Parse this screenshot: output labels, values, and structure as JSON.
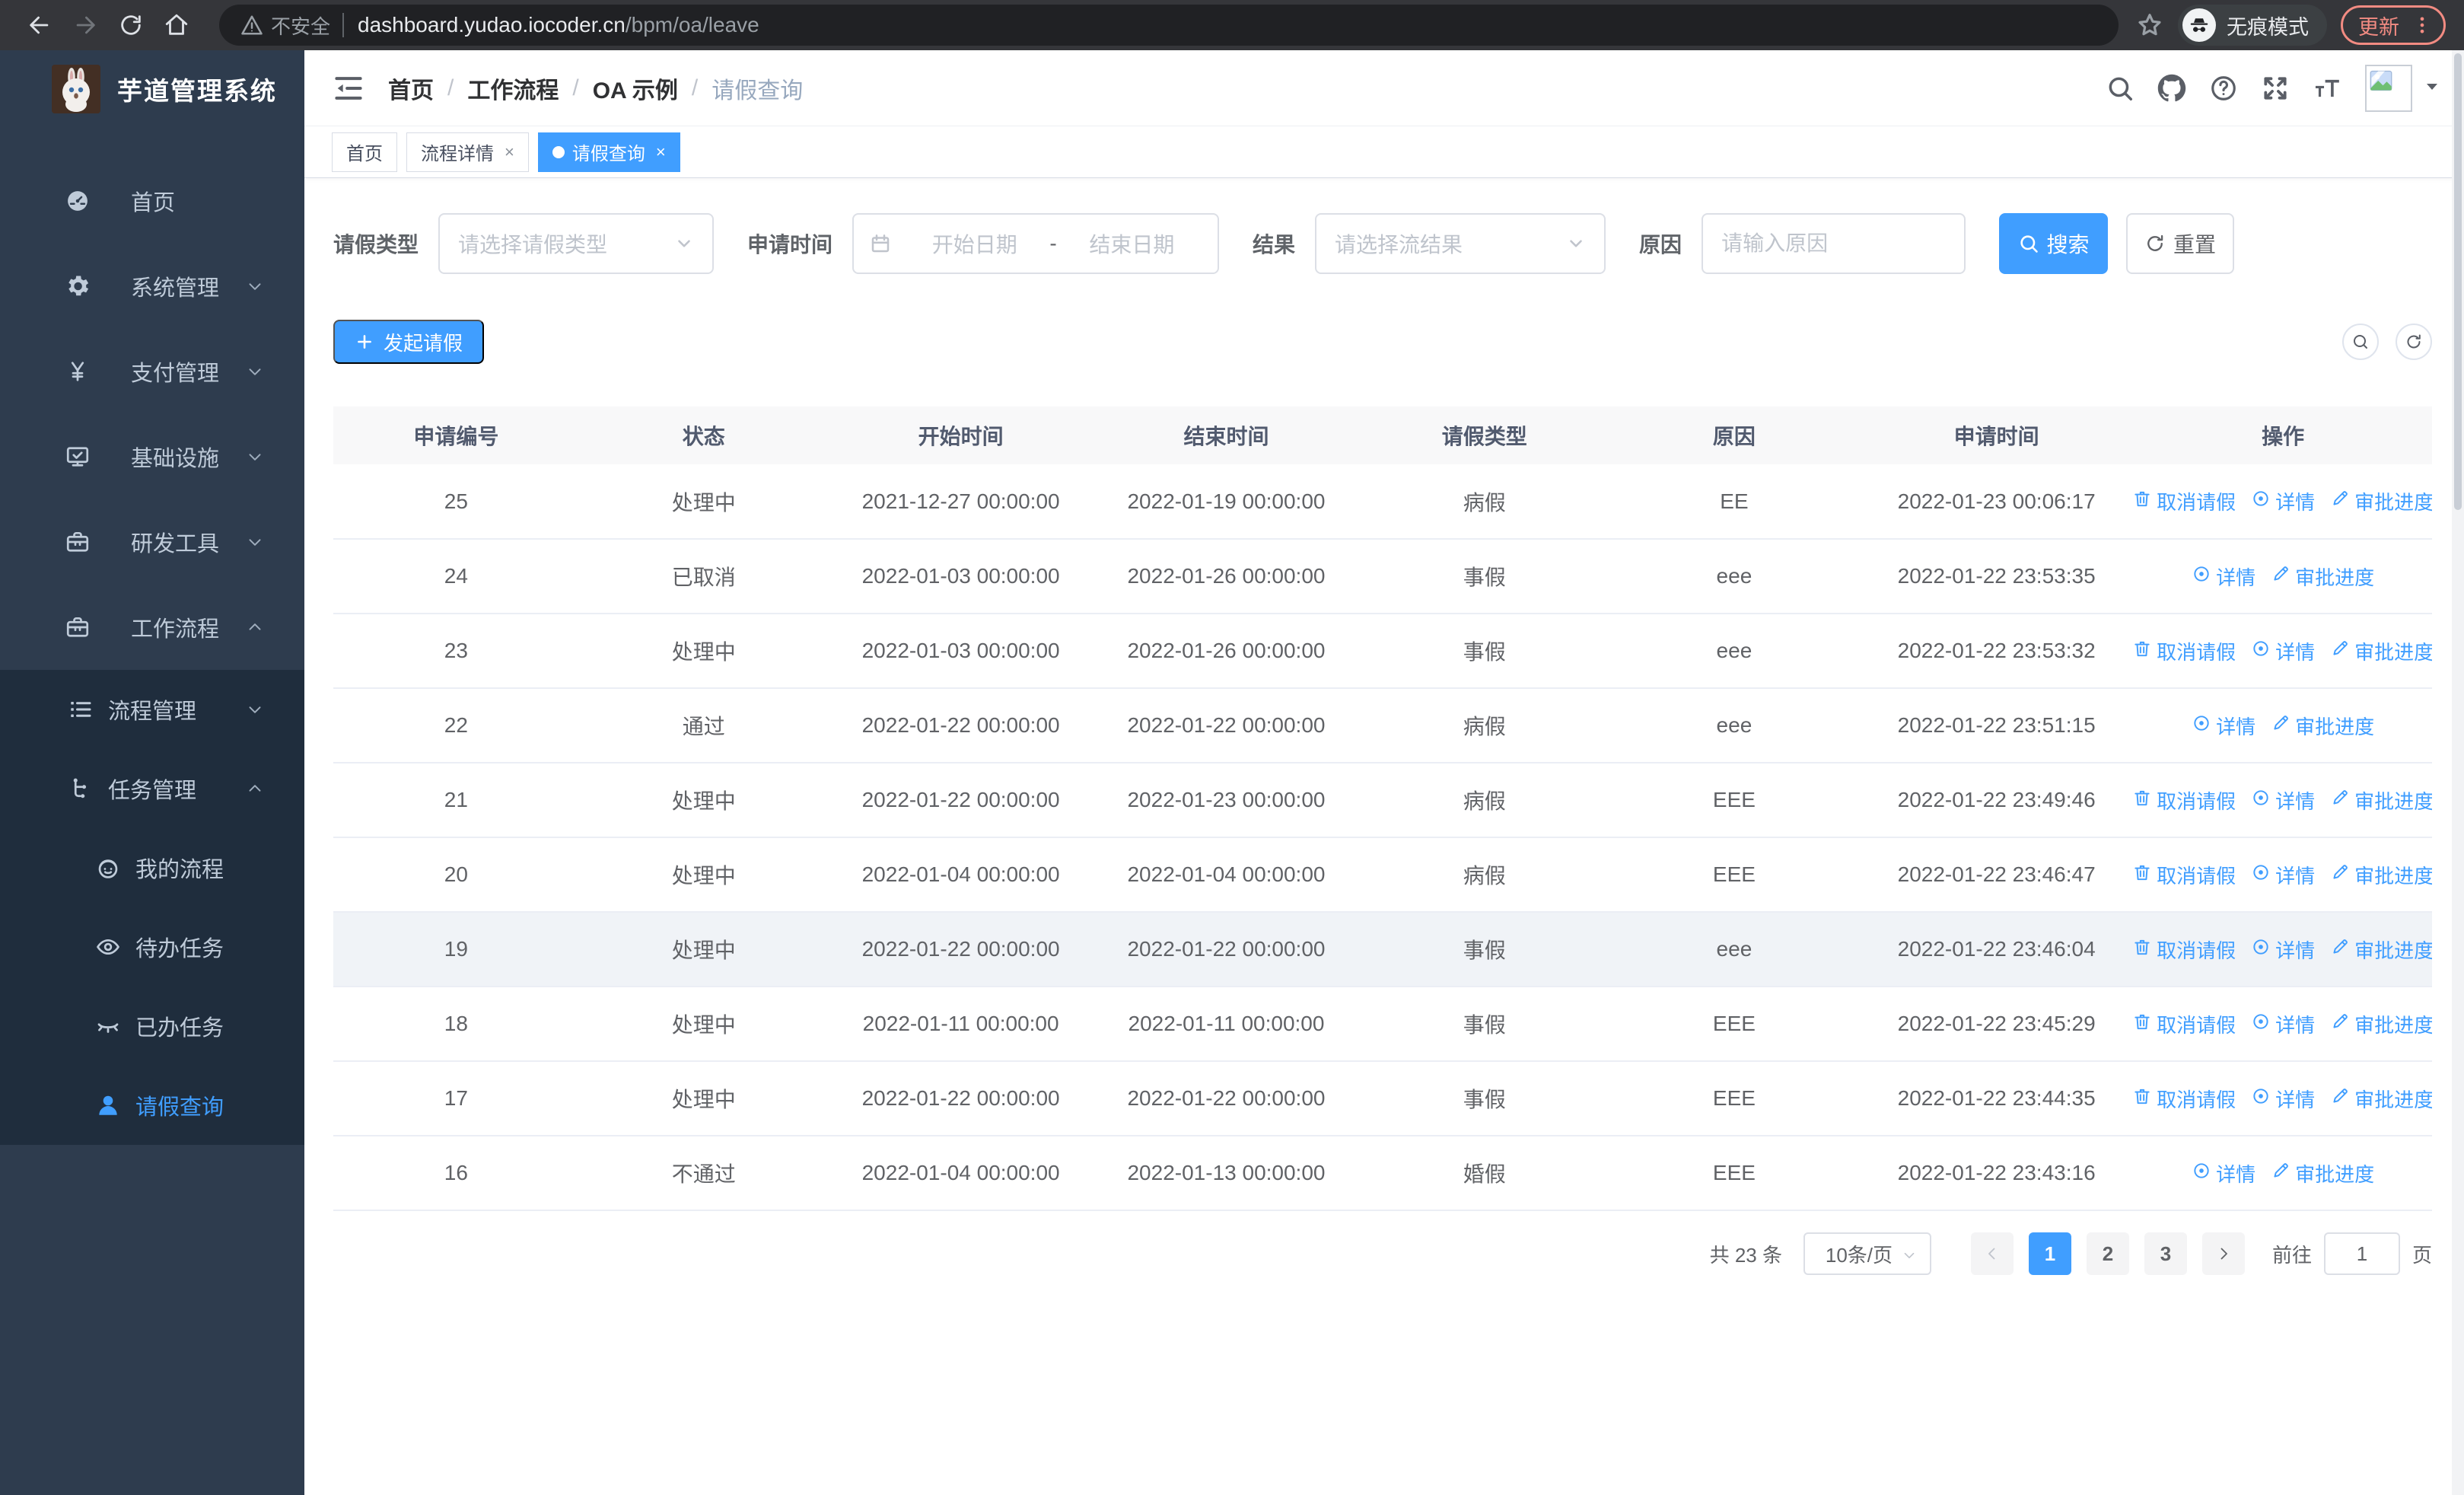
{
  "browser": {
    "security_label": "不安全",
    "url_host": "dashboard.yudao.iocoder.cn",
    "url_path": "/bpm/oa/leave",
    "incognito_label": "无痕模式",
    "update_label": "更新"
  },
  "sidebar": {
    "title": "芋道管理系统",
    "menu": [
      {
        "label": "首页",
        "icon": "dashboard-icon",
        "level": 1,
        "arrow": null,
        "active": false
      },
      {
        "label": "系统管理",
        "icon": "gear-icon",
        "level": 1,
        "arrow": "down",
        "active": false
      },
      {
        "label": "支付管理",
        "icon": "yen-icon",
        "level": 1,
        "arrow": "down",
        "active": false
      },
      {
        "label": "基础设施",
        "icon": "monitor-icon",
        "level": 1,
        "arrow": "down",
        "active": false
      },
      {
        "label": "研发工具",
        "icon": "toolbox-icon",
        "level": 1,
        "arrow": "down",
        "active": false
      },
      {
        "label": "工作流程",
        "icon": "briefcase-icon",
        "level": 1,
        "arrow": "up",
        "active": false
      }
    ],
    "submenu": [
      {
        "label": "流程管理",
        "icon": "tree-list-icon",
        "level": 2,
        "arrow": "down",
        "active": false
      },
      {
        "label": "任务管理",
        "icon": "org-branch-icon",
        "level": 2,
        "arrow": "up",
        "active": false
      },
      {
        "label": "我的流程",
        "icon": "face-icon",
        "level": 3,
        "arrow": null,
        "active": false
      },
      {
        "label": "待办任务",
        "icon": "eye-open-icon",
        "level": 3,
        "arrow": null,
        "active": false
      },
      {
        "label": "已办任务",
        "icon": "eye-closed-icon",
        "level": 3,
        "arrow": null,
        "active": false
      },
      {
        "label": "请假查询",
        "icon": "user-icon",
        "level": 3,
        "arrow": null,
        "active": true
      }
    ]
  },
  "header": {
    "breadcrumb": [
      "首页",
      "工作流程",
      "OA 示例",
      "请假查询"
    ],
    "icons": [
      "search-icon",
      "github-icon",
      "help-icon",
      "fullscreen-icon",
      "font-size-icon"
    ]
  },
  "tabs": [
    {
      "label": "首页",
      "closable": false,
      "active": false
    },
    {
      "label": "流程详情",
      "closable": true,
      "active": false
    },
    {
      "label": "请假查询",
      "closable": true,
      "active": true
    }
  ],
  "filters": {
    "type_label": "请假类型",
    "type_placeholder": "请选择请假类型",
    "time_label": "申请时间",
    "date_start_placeholder": "开始日期",
    "date_separator": "-",
    "date_end_placeholder": "结束日期",
    "result_label": "结果",
    "result_placeholder": "请选择流结果",
    "reason_label": "原因",
    "reason_placeholder": "请输入原因",
    "search_label": "搜索",
    "reset_label": "重置"
  },
  "toolbar": {
    "create_label": "发起请假"
  },
  "table": {
    "columns": [
      "申请编号",
      "状态",
      "开始时间",
      "结束时间",
      "请假类型",
      "原因",
      "申请时间",
      "操作"
    ],
    "action_labels": {
      "cancel": "取消请假",
      "detail": "详情",
      "progress": "审批进度"
    },
    "rows": [
      {
        "id": "25",
        "status": "处理中",
        "start": "2021-12-27 00:00:00",
        "end": "2022-01-19 00:00:00",
        "type": "病假",
        "reason": "EE",
        "apply": "2022-01-23 00:06:17",
        "cancel": true,
        "hover": false
      },
      {
        "id": "24",
        "status": "已取消",
        "start": "2022-01-03 00:00:00",
        "end": "2022-01-26 00:00:00",
        "type": "事假",
        "reason": "eee",
        "apply": "2022-01-22 23:53:35",
        "cancel": false,
        "hover": false
      },
      {
        "id": "23",
        "status": "处理中",
        "start": "2022-01-03 00:00:00",
        "end": "2022-01-26 00:00:00",
        "type": "事假",
        "reason": "eee",
        "apply": "2022-01-22 23:53:32",
        "cancel": true,
        "hover": false
      },
      {
        "id": "22",
        "status": "通过",
        "start": "2022-01-22 00:00:00",
        "end": "2022-01-22 00:00:00",
        "type": "病假",
        "reason": "eee",
        "apply": "2022-01-22 23:51:15",
        "cancel": false,
        "hover": false
      },
      {
        "id": "21",
        "status": "处理中",
        "start": "2022-01-22 00:00:00",
        "end": "2022-01-23 00:00:00",
        "type": "病假",
        "reason": "EEE",
        "apply": "2022-01-22 23:49:46",
        "cancel": true,
        "hover": false
      },
      {
        "id": "20",
        "status": "处理中",
        "start": "2022-01-04 00:00:00",
        "end": "2022-01-04 00:00:00",
        "type": "病假",
        "reason": "EEE",
        "apply": "2022-01-22 23:46:47",
        "cancel": true,
        "hover": false
      },
      {
        "id": "19",
        "status": "处理中",
        "start": "2022-01-22 00:00:00",
        "end": "2022-01-22 00:00:00",
        "type": "事假",
        "reason": "eee",
        "apply": "2022-01-22 23:46:04",
        "cancel": true,
        "hover": true
      },
      {
        "id": "18",
        "status": "处理中",
        "start": "2022-01-11 00:00:00",
        "end": "2022-01-11 00:00:00",
        "type": "事假",
        "reason": "EEE",
        "apply": "2022-01-22 23:45:29",
        "cancel": true,
        "hover": false
      },
      {
        "id": "17",
        "status": "处理中",
        "start": "2022-01-22 00:00:00",
        "end": "2022-01-22 00:00:00",
        "type": "事假",
        "reason": "EEE",
        "apply": "2022-01-22 23:44:35",
        "cancel": true,
        "hover": false
      },
      {
        "id": "16",
        "status": "不通过",
        "start": "2022-01-04 00:00:00",
        "end": "2022-01-13 00:00:00",
        "type": "婚假",
        "reason": "EEE",
        "apply": "2022-01-22 23:43:16",
        "cancel": false,
        "hover": false
      }
    ]
  },
  "pagination": {
    "total_label": "共 23 条",
    "page_size": "10条/页",
    "pages": [
      "1",
      "2",
      "3"
    ],
    "active_page": "1",
    "goto_label": "前往",
    "goto_value": "1",
    "page_unit": "页"
  },
  "colors": {
    "accent": "#409eff",
    "sidebar_bg": "#2e3c4e",
    "submenu_bg": "#1f2d3d",
    "update_red": "#f28b82"
  }
}
